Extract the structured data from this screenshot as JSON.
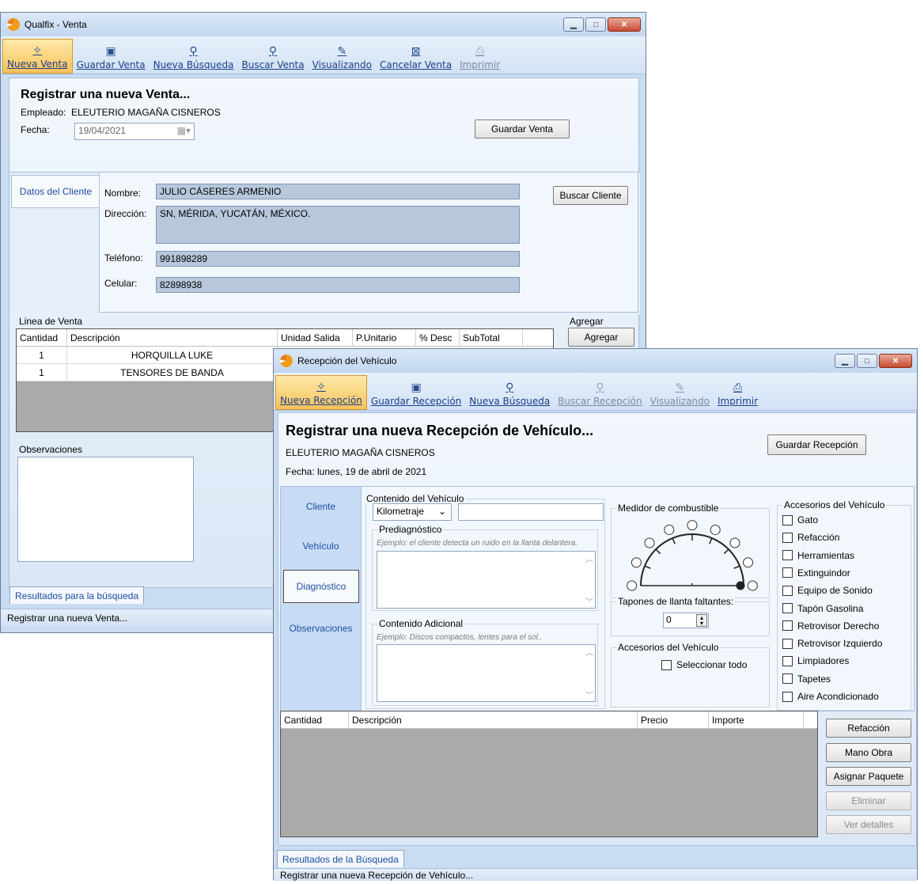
{
  "venta": {
    "title": "Qualfix - Venta",
    "toolbar": [
      {
        "label": "Nueva Venta",
        "icon": "new-doc-icon",
        "glyph": "✧",
        "state": "active"
      },
      {
        "label": "Guardar Venta",
        "icon": "save-icon",
        "glyph": "▣",
        "state": "normal"
      },
      {
        "label": "Nueva Búsqueda",
        "icon": "search-icon",
        "glyph": "⚲",
        "state": "normal"
      },
      {
        "label": "Buscar Venta",
        "icon": "find-record-icon",
        "glyph": "⚲",
        "state": "normal"
      },
      {
        "label": "Visualizando",
        "icon": "view-icon",
        "glyph": "✎",
        "state": "normal"
      },
      {
        "label": "Cancelar Venta",
        "icon": "cancel-icon",
        "glyph": "⊠",
        "state": "normal"
      },
      {
        "label": "Imprimir",
        "icon": "print-icon",
        "glyph": "⎙",
        "state": "disabled"
      }
    ],
    "heading": "Registrar una nueva Venta...",
    "empleado_label": "Empleado:",
    "empleado": "ELEUTERIO MAGAÑA CISNEROS",
    "fecha_label": "Fecha:",
    "fecha": "19/04/2021",
    "guardar_btn": "Guardar Venta",
    "cliente_tab": "Datos del Cliente",
    "nombre_label": "Nombre:",
    "nombre": "JULIO CÁSERES ARMENIO",
    "direccion_label": "Dirección:",
    "direccion": "SN, MÉRIDA, YUCATÁN, MÉXICO.",
    "telefono_label": "Teléfono:",
    "telefono": "991898289",
    "celular_label": "Celular:",
    "celular": "82898938",
    "buscar_cliente_btn": "Buscar Cliente",
    "linea_label": "Linea de Venta",
    "agregar_label": "Agregar",
    "agregar_btn": "Agregar",
    "columns": [
      "Cantidad",
      "Descripción",
      "Unidad Salida",
      "P.Unitario",
      "% Desc",
      "SubTotal"
    ],
    "rows": [
      {
        "cantidad": "1",
        "descripcion": "HORQUILLA LUKE"
      },
      {
        "cantidad": "1",
        "descripcion": "TENSORES DE BANDA"
      }
    ],
    "observaciones_label": "Observaciones",
    "resultados_tab": "Resultados para la búsqueda",
    "status": "Registrar una nueva Venta..."
  },
  "recepcion": {
    "title": "Recepción del Vehículo",
    "toolbar": [
      {
        "label": "Nueva Recepción",
        "icon": "new-doc-icon",
        "glyph": "✧",
        "state": "active"
      },
      {
        "label": "Guardar Recepción",
        "icon": "save-icon",
        "glyph": "▣",
        "state": "normal"
      },
      {
        "label": "Nueva Búsqueda",
        "icon": "search-icon",
        "glyph": "⚲",
        "state": "normal"
      },
      {
        "label": "Buscar Recepción",
        "icon": "find-record-icon",
        "glyph": "⚲",
        "state": "disabled"
      },
      {
        "label": "Visualizando",
        "icon": "view-icon",
        "glyph": "✎",
        "state": "disabled"
      },
      {
        "label": "Imprimir",
        "icon": "print-icon",
        "glyph": "⎙",
        "state": "normal"
      }
    ],
    "heading": "Registrar una nueva Recepción de Vehículo...",
    "empleado": "ELEUTERIO MAGAÑA CISNEROS",
    "fecha": "Fecha:  lunes, 19 de abril de 2021",
    "guardar_btn": "Guardar Recepción",
    "tabs": [
      "Cliente",
      "Vehículo",
      "Diagnóstico",
      "Observaciones"
    ],
    "active_tab": "Diagnóstico",
    "contenido_title": "Contenido del Vehículo",
    "kilometraje_select": "Kilometraje",
    "prediagnostico_label": "Prediagnóstico",
    "prediagnostico_hint": "Ejemplo: el cliente detecta un ruido en la llanta delantera.",
    "contenido_adicional_label": "Contenido Adicional",
    "contenido_adicional_hint": "Ejemplo: Discos compactos, lentes para el sol..",
    "medidor_title": "Medidor de combustible",
    "fuel_level": 1.0,
    "tapones_label": "Tapones de llanta faltantes:",
    "tapones_value": "0",
    "accesorios_sel_title": "Accesorios del Vehículo",
    "seleccionar_todo": "Seleccionar todo",
    "accesorios_title": "Accesorios del Vehículo",
    "accesorios": [
      "Gato",
      "Refacción",
      "Herramientas",
      "Extinguindor",
      "Equipo de Sonido",
      "Tapón Gasolina",
      "Retrovisor Derecho",
      "Retrovisor Izquierdo",
      "Limpiadores",
      "Tapetes",
      "Aire Acondicionado"
    ],
    "columns": [
      "Cantidad",
      "Descripción",
      "Precio",
      "Importe"
    ],
    "side_buttons": [
      {
        "label": "Refacción",
        "disabled": false
      },
      {
        "label": "Mano Obra",
        "disabled": false
      },
      {
        "label": "Asignar Paquete",
        "disabled": false
      },
      {
        "label": "Eliminar",
        "disabled": true
      },
      {
        "label": "Ver detalles",
        "disabled": true
      }
    ],
    "resultados_tab": "Resultados de la Búsqueda",
    "status": "Registrar una nueva Recepción de Vehículo..."
  }
}
